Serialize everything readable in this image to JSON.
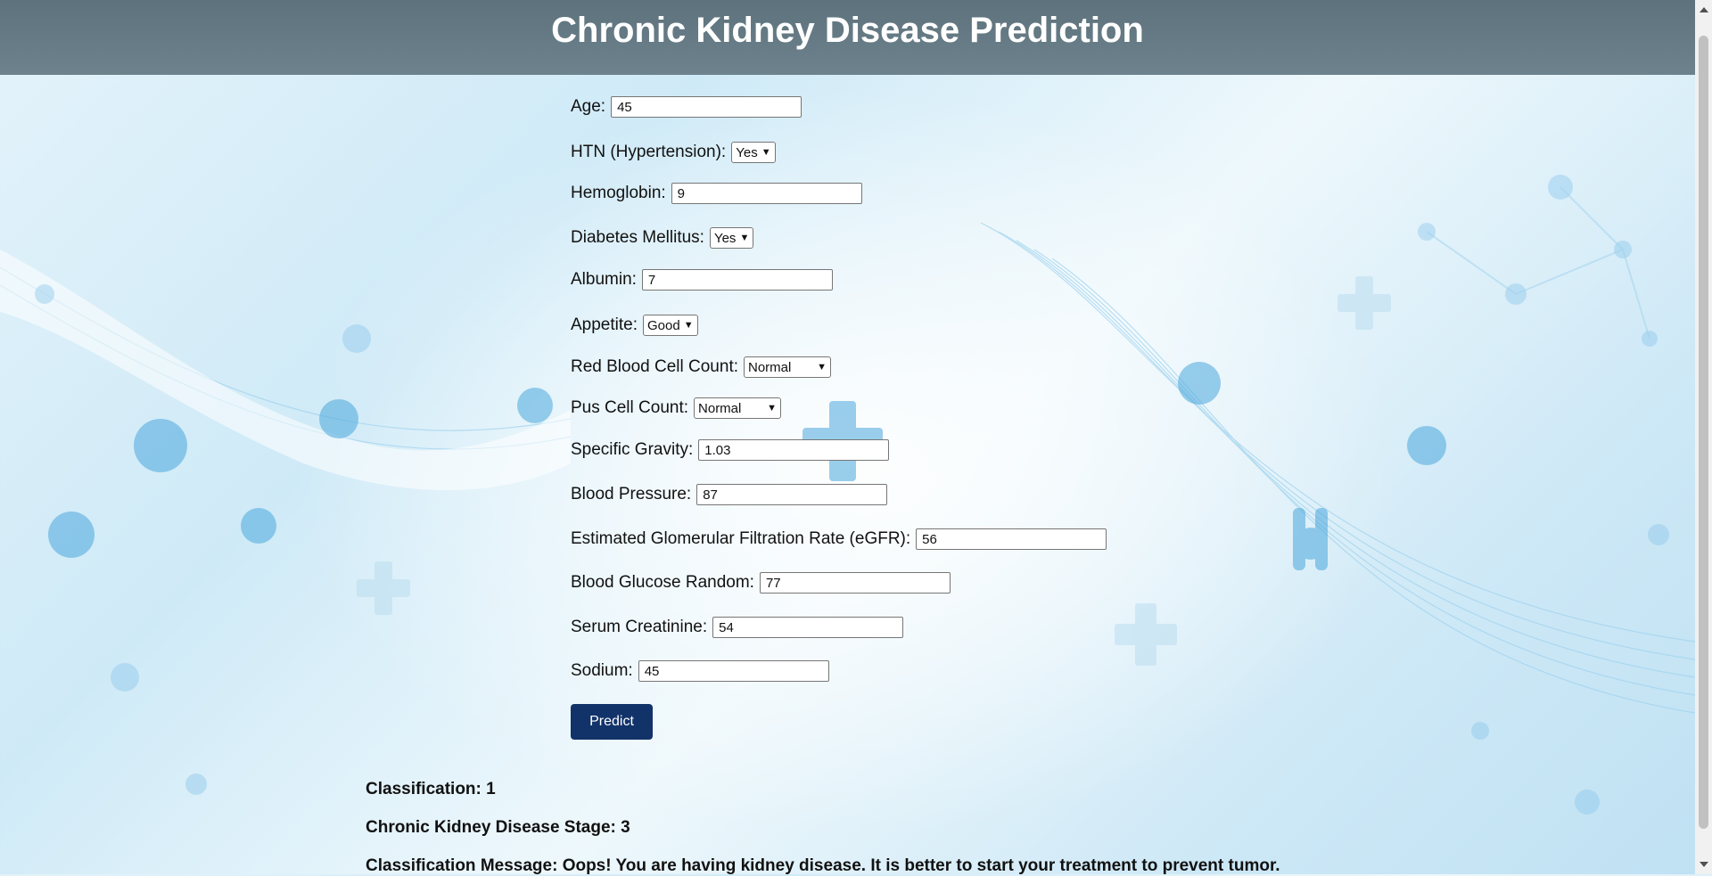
{
  "header": {
    "title": "Chronic Kidney Disease Prediction"
  },
  "form": {
    "age": {
      "label": "Age:",
      "value": "45"
    },
    "htn": {
      "label": "HTN (Hypertension):",
      "value": "Yes"
    },
    "hemoglobin": {
      "label": "Hemoglobin:",
      "value": "9"
    },
    "diabetes": {
      "label": "Diabetes Mellitus:",
      "value": "Yes"
    },
    "albumin": {
      "label": "Albumin:",
      "value": "7"
    },
    "appetite": {
      "label": "Appetite:",
      "value": "Good"
    },
    "rbc": {
      "label": "Red Blood Cell Count:",
      "value": "Normal"
    },
    "pus": {
      "label": "Pus Cell Count:",
      "value": "Normal"
    },
    "sg": {
      "label": "Specific Gravity:",
      "value": "1.03"
    },
    "bp": {
      "label": "Blood Pressure:",
      "value": "87"
    },
    "egfr": {
      "label": "Estimated Glomerular Filtration Rate (eGFR):",
      "value": "56"
    },
    "bgr": {
      "label": "Blood Glucose Random:",
      "value": "77"
    },
    "sc": {
      "label": "Serum Creatinine:",
      "value": "54"
    },
    "sodium": {
      "label": "Sodium:",
      "value": "45"
    },
    "predict_label": "Predict"
  },
  "results": {
    "classification": "Classification: 1",
    "stage": "Chronic Kidney Disease Stage: 3",
    "message": "Classification Message: Oops! You are having kidney disease. It is better to start your treatment to prevent tumor."
  },
  "colors": {
    "header": "#667b85",
    "button": "#12336a",
    "accent": "#3fa0d6"
  }
}
